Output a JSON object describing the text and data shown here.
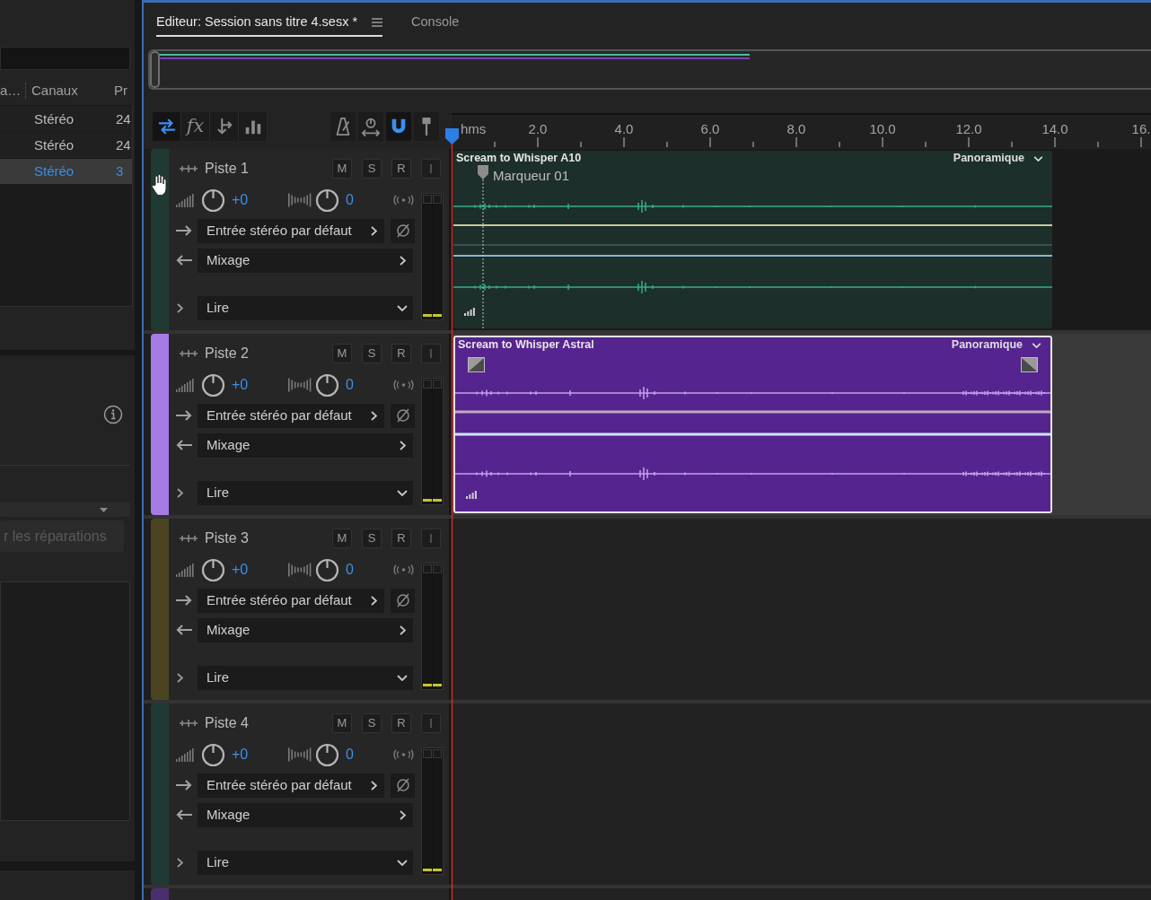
{
  "files_panel": {
    "columns": [
      "a…",
      "Canaux",
      "Pr"
    ],
    "rows": [
      {
        "cells": [
          "",
          "Stéréo",
          "24"
        ],
        "selected": false
      },
      {
        "cells": [
          "",
          "Stéréo",
          "24"
        ],
        "selected": false
      },
      {
        "cells": [
          "",
          "Stéréo",
          "3"
        ],
        "selected": true
      }
    ]
  },
  "repair_panel": {
    "apply_button": {
      "label": "r les réparations",
      "disabled": true
    }
  },
  "editor": {
    "tabs": [
      {
        "label": "Editeur: Session sans titre 4.sesx *",
        "selected": true
      },
      {
        "label": "Console",
        "selected": false
      }
    ],
    "tools": [
      {
        "kind": "multitrack",
        "on": true
      },
      {
        "kind": "fx",
        "label": "fx",
        "on": false
      },
      {
        "kind": "sends",
        "on": false
      },
      {
        "kind": "eq",
        "on": false
      }
    ],
    "snap_tools": [
      {
        "kind": "metronome",
        "on": false
      },
      {
        "kind": "stretch",
        "on": false
      },
      {
        "kind": "snap",
        "on": true
      },
      {
        "kind": "marker",
        "on": false
      }
    ],
    "ruler": {
      "unit": "hms",
      "labels": [
        "2.0",
        "4.0",
        "6.0",
        "8.0",
        "10.0",
        "12.0",
        "14.0",
        "16."
      ]
    },
    "tracks": [
      {
        "name": "Piste 1",
        "color": "#1e3a33",
        "selected": false,
        "buttons": [
          "M",
          "S",
          "R"
        ],
        "volume": "+0",
        "pan": "0",
        "input": "Entrée stéréo par défaut",
        "output": "Mixage",
        "automation": "Lire",
        "meter": [
          {
            "level": 0.02
          },
          {
            "level": 0.02
          }
        ],
        "clip": {
          "name": "Scream to Whisper A10",
          "mode": "Panoramique",
          "color": "#1c2f2a",
          "selected": false,
          "marker": "Marqueur 01"
        }
      },
      {
        "name": "Piste 2",
        "color": "#a57be6",
        "selected": true,
        "buttons": [
          "M",
          "S",
          "R"
        ],
        "volume": "+0",
        "pan": "0",
        "input": "Entrée stéréo par défaut",
        "output": "Mixage",
        "automation": "Lire",
        "meter": [
          {
            "level": 0.02
          },
          {
            "level": 0.02
          }
        ],
        "clip": {
          "name": "Scream to Whisper Astral",
          "mode": "Panoramique",
          "color": "#55248f",
          "selected": true
        }
      },
      {
        "name": "Piste 3",
        "color": "#4b4421",
        "selected": false,
        "buttons": [
          "M",
          "S",
          "R"
        ],
        "volume": "+0",
        "pan": "0",
        "input": "Entrée stéréo par défaut",
        "output": "Mixage",
        "automation": "Lire",
        "meter": [
          {
            "level": 0.02
          },
          {
            "level": 0.02
          }
        ]
      },
      {
        "name": "Piste 4",
        "color": "#1f3934",
        "selected": false,
        "buttons": [
          "M",
          "S",
          "R"
        ],
        "volume": "+0",
        "pan": "0",
        "input": "Entrée stéréo par défaut",
        "output": "Mixage",
        "automation": "Lire",
        "meter": [
          {
            "level": 0.02
          },
          {
            "level": 0.02
          }
        ]
      }
    ],
    "cut_track": {
      "color": "#4a2f6e"
    }
  }
}
